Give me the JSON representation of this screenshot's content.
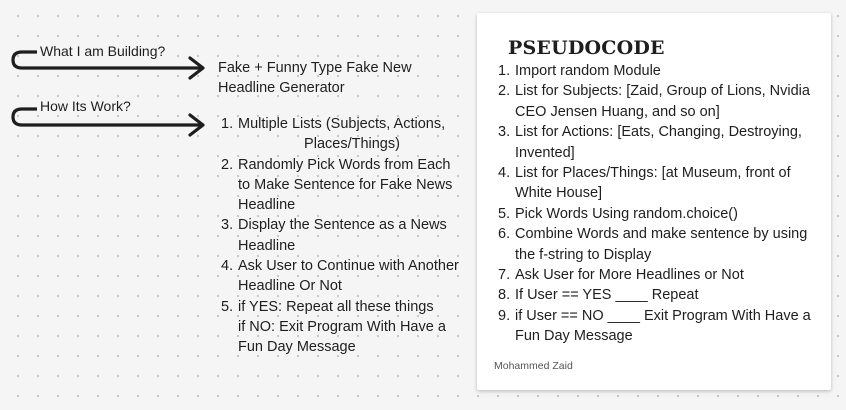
{
  "arrows": [
    {
      "label": "What I am Building?",
      "target_text": "Fake + Funny Type Fake New Headline Generator"
    },
    {
      "label": "How Its Work?"
    }
  ],
  "how_steps": [
    {
      "number": "1.",
      "text": "Multiple Lists (Subjects, Actions,",
      "subtext": "Places/Things)"
    },
    {
      "number": "2.",
      "text": "Randomly Pick Words from Each to Make Sentence for Fake News Headline"
    },
    {
      "number": "3.",
      "text": "Display the Sentence as a News Headline"
    },
    {
      "number": "4.",
      "text": "Ask User to Continue with Another Headline Or Not"
    },
    {
      "number": "5.",
      "text": "if YES: Repeat all these things",
      "subtext": "if NO: Exit Program With Have a Fun Day Message"
    }
  ],
  "pseudocode": {
    "title": "PSEUDOCODE",
    "steps": [
      {
        "number": "1.",
        "text": "Import random Module"
      },
      {
        "number": "2.",
        "text": "List for Subjects: [Zaid, Group of Lions, Nvidia CEO Jensen Huang, and so on]"
      },
      {
        "number": "3.",
        "text": "List for Actions: [Eats, Changing, Destroying, Invented]"
      },
      {
        "number": "4.",
        "text": "List for Places/Things: [at Museum, front of White House]"
      },
      {
        "number": "5.",
        "text": "Pick Words Using random.choice()"
      },
      {
        "number": "6.",
        "text": "Combine Words and make sentence by using the f-string to Display"
      },
      {
        "number": "7.",
        "text": "Ask User for More Headlines or Not"
      },
      {
        "number": "8.",
        "text": "If User == YES ____ Repeat"
      },
      {
        "number": "9.",
        "text": "if User == NO ____ Exit Program With Have a Fun Day Message"
      }
    ],
    "author": "Mohammed Zaid"
  },
  "colors": {
    "background": "#f5f5f5",
    "grid_dot": "#c4c4c4",
    "ink": "#1e1e1e",
    "card": "#ffffff"
  }
}
